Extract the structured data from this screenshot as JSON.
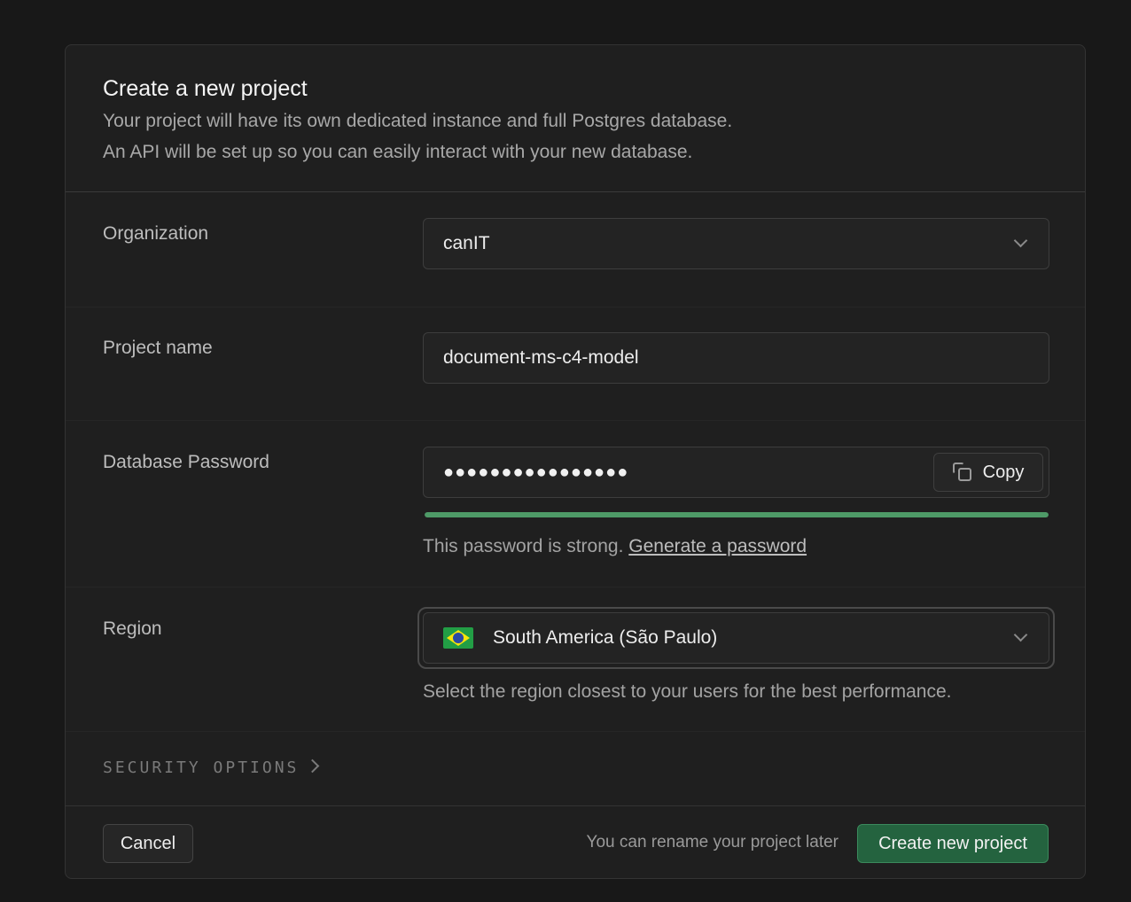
{
  "header": {
    "title": "Create a new project",
    "description_line1": "Your project will have its own dedicated instance and full Postgres database.",
    "description_line2": "An API will be set up so you can easily interact with your new database."
  },
  "organization": {
    "label": "Organization",
    "value": "canIT"
  },
  "project_name": {
    "label": "Project name",
    "value": "document-ms-c4-model"
  },
  "database_password": {
    "label": "Database Password",
    "masked_value": "●●●●●●●●●●●●●●●●",
    "copy_label": "Copy",
    "strength_fraction": 1.0,
    "strength_color": "#4e9a67",
    "hint_text": "This password is strong.",
    "generate_link": "Generate a password"
  },
  "region": {
    "label": "Region",
    "value": "South America (São Paulo)",
    "flag_icon": "brazil-flag-icon",
    "hint_text": "Select the region closest to your users for the best performance."
  },
  "security": {
    "label": "SECURITY OPTIONS"
  },
  "footer": {
    "cancel_label": "Cancel",
    "note": "You can rename your project later",
    "create_label": "Create new project",
    "create_color": "#24633f"
  }
}
